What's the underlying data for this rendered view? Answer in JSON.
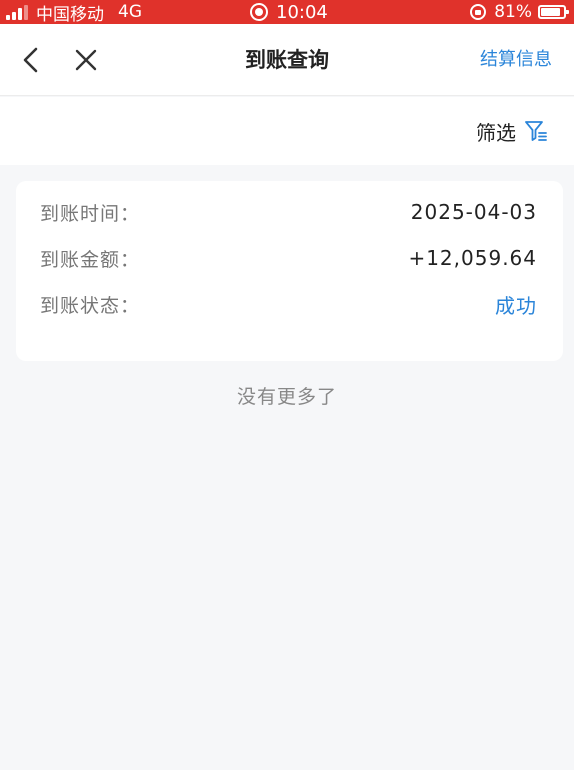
{
  "status_bar": {
    "carrier": "中国移动",
    "network": "4G",
    "time": "10:04",
    "battery": "81%",
    "icons": [
      "signal-icon",
      "screen-record-icon",
      "rotation-lock-icon",
      "battery-icon"
    ]
  },
  "nav": {
    "title": "到账查询",
    "right_link": "结算信息",
    "icons": [
      "back-chevron-icon",
      "close-icon"
    ]
  },
  "filter": {
    "label": "筛选",
    "icon": "filter-icon"
  },
  "record": {
    "time_label": "到账时间：",
    "time_value": "2025-04-03",
    "amount_label": "到账金额：",
    "amount_value": "+12,059.64",
    "status_label": "到账状态：",
    "status_value": "成功"
  },
  "list_end": "没有更多了",
  "colors": {
    "status_bar_bg": "#e0322b",
    "accent": "#2b85d9",
    "page_bg": "#f6f7f9"
  }
}
